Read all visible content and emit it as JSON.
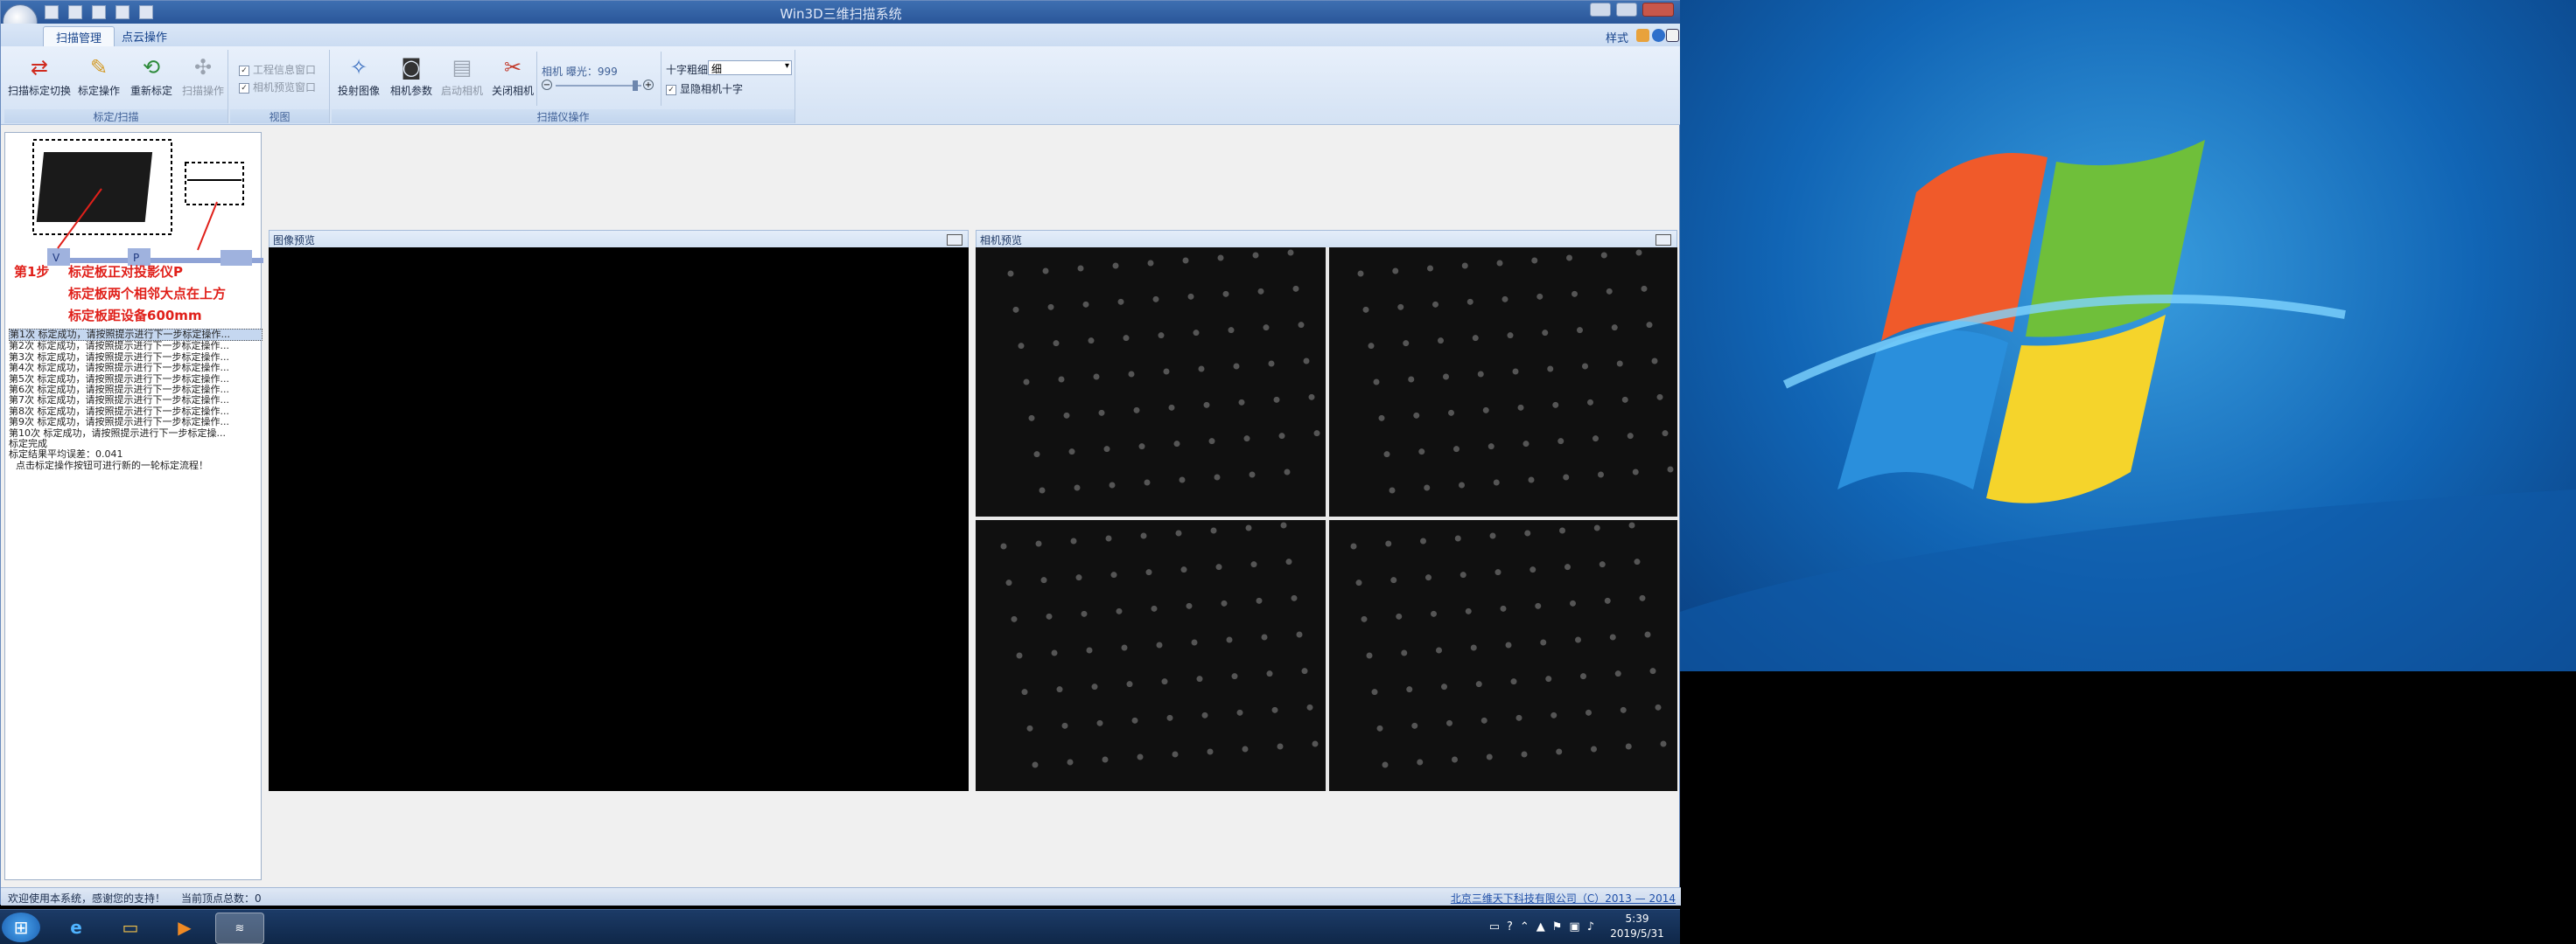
{
  "window": {
    "title": "Win3D三维扫描系统",
    "tabs": [
      "扫描管理",
      "点云操作"
    ],
    "style_menu": "样式"
  },
  "ribbon": {
    "groups": [
      {
        "label": "标定/扫描",
        "buttons": [
          "扫描标定切换",
          "标定操作",
          "重新标定",
          "扫描操作"
        ]
      },
      {
        "label": "视图",
        "checkboxes": [
          "工程信息窗口",
          "相机预览窗口"
        ]
      },
      {
        "label": "扫描仪操作",
        "buttons": [
          "投射图像",
          "相机参数",
          "启动相机",
          "关闭相机"
        ]
      }
    ],
    "exposure_label": "相机 曝光：999",
    "crosshair_label": "十字粗细",
    "crosshair_value": "细",
    "hide_crosshair_label": "显隐相机十字"
  },
  "left_panel": {
    "step_label": "第1步",
    "instructions": [
      "标定板正对投影仪P",
      "标定板两个相邻大点在上方",
      "标定板距设备600mm"
    ],
    "diagram_labels": [
      "V",
      "P"
    ],
    "log": [
      "第1次 标定成功，请按照提示进行下一步标定操作...",
      "第2次 标定成功，请按照提示进行下一步标定操作...",
      "第3次 标定成功，请按照提示进行下一步标定操作...",
      "第4次 标定成功，请按照提示进行下一步标定操作...",
      "第5次 标定成功，请按照提示进行下一步标定操作...",
      "第6次 标定成功，请按照提示进行下一步标定操作...",
      "第7次 标定成功，请按照提示进行下一步标定操作...",
      "第8次 标定成功，请按照提示进行下一步标定操作...",
      "第9次 标定成功，请按照提示进行下一步标定操作...",
      "第10次 标定成功，请按照提示进行下一步标定操...",
      "标定完成",
      "标定结果平均误差：0.041",
      "点击标定操作按钮可进行新的一轮标定流程！"
    ]
  },
  "panes": {
    "image_preview": "图像预览",
    "camera_preview": "相机预览"
  },
  "status": {
    "welcome": "欢迎使用本系统，感谢您的支持！",
    "vertex_count": "当前顶点总数：0",
    "copyright": "北京三维天下科技有限公司（C）2013 — 2014"
  },
  "taskbar": {
    "time": "5:39",
    "date": "2019/5/31"
  }
}
